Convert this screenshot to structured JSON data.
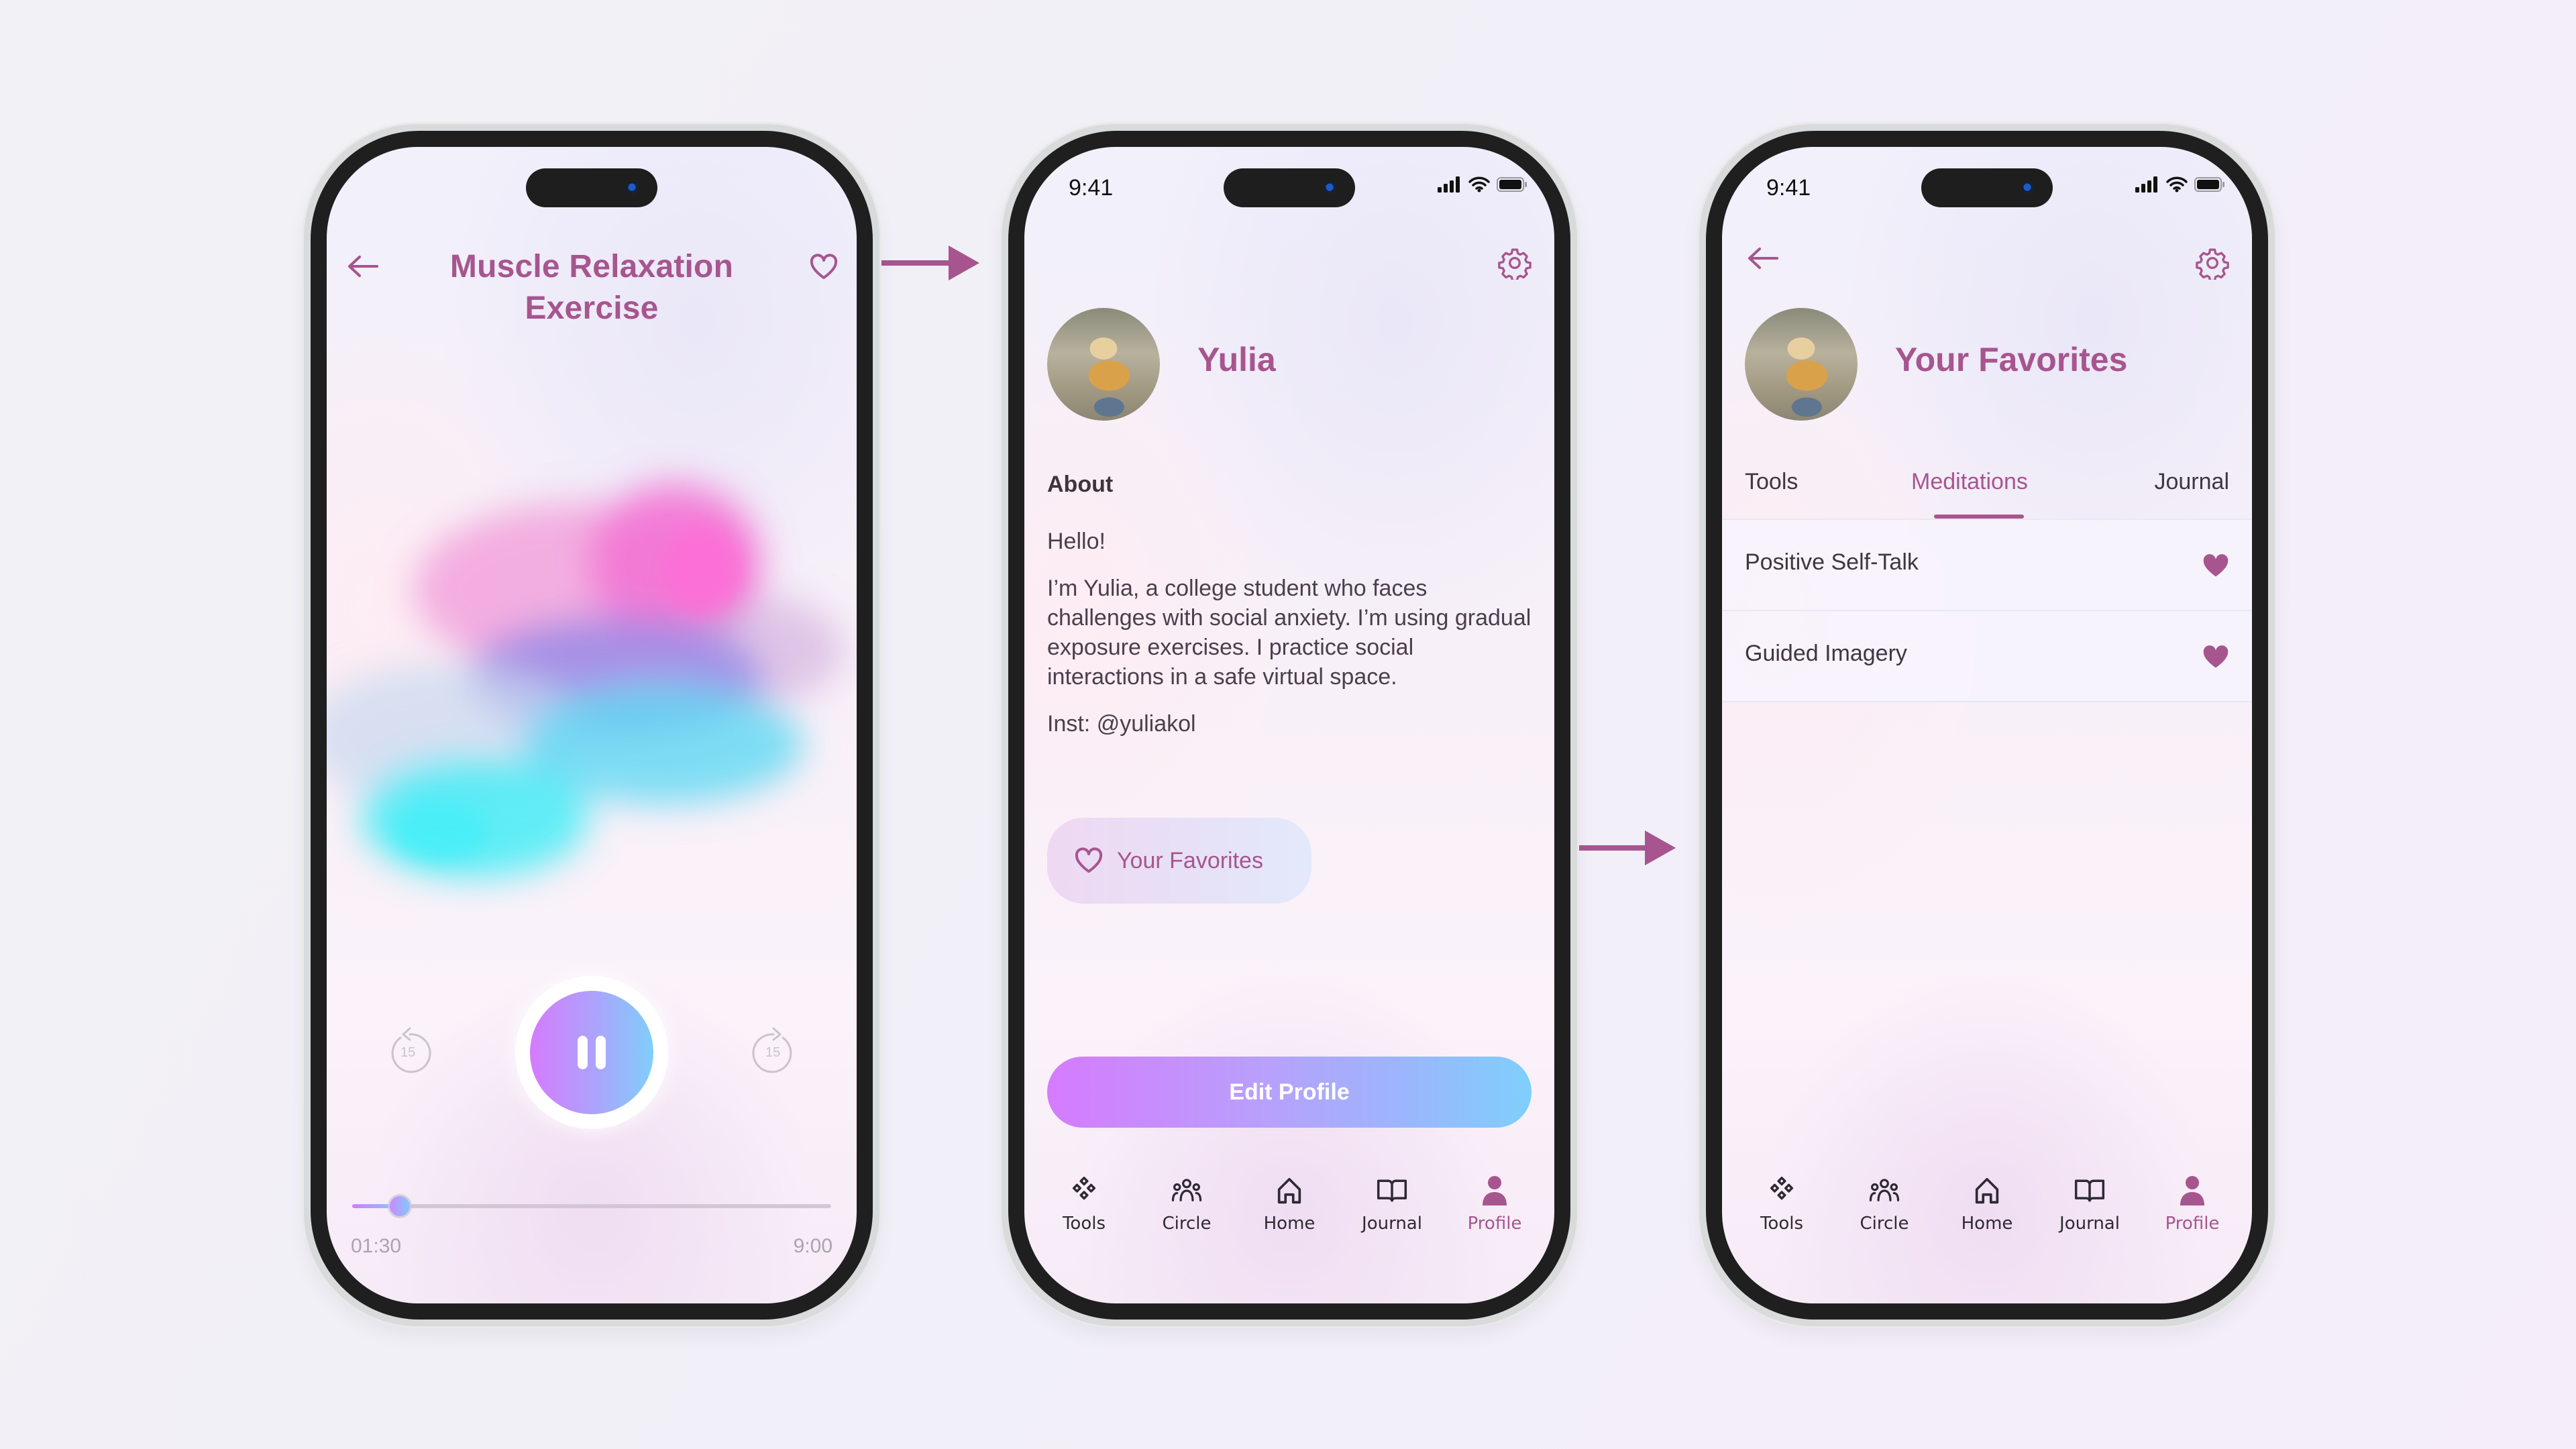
{
  "colors": {
    "accent": "#a7558f",
    "gradient_start": "#d57bfd",
    "gradient_end": "#7fcffc",
    "text_dark": "#3f3642",
    "arrow": "#a7558f"
  },
  "status_bar": {
    "time": "9:41",
    "icons": [
      "cellular-signal-icon",
      "wifi-icon",
      "battery-icon"
    ]
  },
  "player": {
    "title_line1": "Muscle Relaxation",
    "title_line2": "Exercise",
    "favorite_icon": "heart-outline-icon",
    "back_icon": "arrow-left-icon",
    "skip_back_label": "15",
    "skip_forward_label": "15",
    "state": "playing",
    "elapsed": "01:30",
    "duration": "9:00",
    "progress_fraction": 0.1
  },
  "profile": {
    "name": "Yulia",
    "settings_icon": "gear-icon",
    "about_heading": "About",
    "bio": [
      "Hello!",
      "I’m Yulia, a college student who faces challenges with social anxiety. I’m using gradual exposure exercises. I practice social interactions in a safe virtual space.",
      "Inst: @yuliakol"
    ],
    "favorites_button": "Your Favorites",
    "edit_button": "Edit Profile"
  },
  "favorites": {
    "title": "Your Favorites",
    "tabs": [
      {
        "label": "Tools",
        "active": false
      },
      {
        "label": "Meditations",
        "active": true
      },
      {
        "label": "Journal",
        "active": false
      }
    ],
    "items": [
      {
        "label": "Positive Self-Talk",
        "favorited": true
      },
      {
        "label": "Guided Imagery",
        "favorited": true
      }
    ]
  },
  "tabbar": {
    "items": [
      {
        "label": "Tools",
        "icon": "diamonds-icon",
        "active": false
      },
      {
        "label": "Circle",
        "icon": "people-group-icon",
        "active": false
      },
      {
        "label": "Home",
        "icon": "home-icon",
        "active": false
      },
      {
        "label": "Journal",
        "icon": "open-book-icon",
        "active": false
      },
      {
        "label": "Profile",
        "icon": "person-icon",
        "active": true
      }
    ]
  }
}
